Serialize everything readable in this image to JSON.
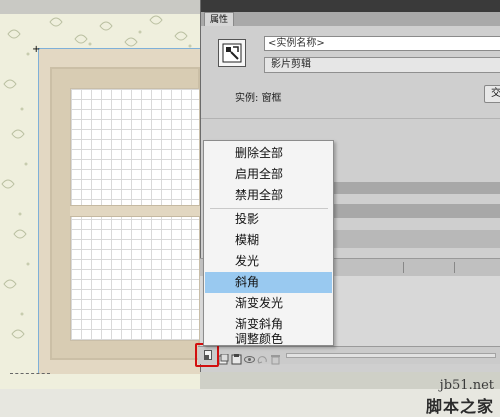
{
  "panel": {
    "tab_label": "属性",
    "instance_name_placeholder": "<实例名称>",
    "symbol_type": "影片剪辑",
    "instance_of_label": "实例:",
    "instance_of_value": "窗框",
    "swap_button_label": "交"
  },
  "filter_menu": {
    "items": [
      "删除全部",
      "启用全部",
      "禁用全部",
      "投影",
      "模糊",
      "发光",
      "斜角",
      "渐变发光",
      "渐变斜角",
      "调整颜色"
    ],
    "selected": "斜角"
  },
  "toolbar": {
    "icons": [
      "add-filter-icon",
      "presets-icon",
      "clipboard-icon",
      "eye-icon",
      "reset-icon",
      "delete-icon"
    ]
  },
  "watermark": {
    "site": "jb51.net",
    "name": "脚本之家"
  },
  "colors": {
    "highlight_border": "#d20f0f",
    "menu_selected": "#99c9f0"
  }
}
